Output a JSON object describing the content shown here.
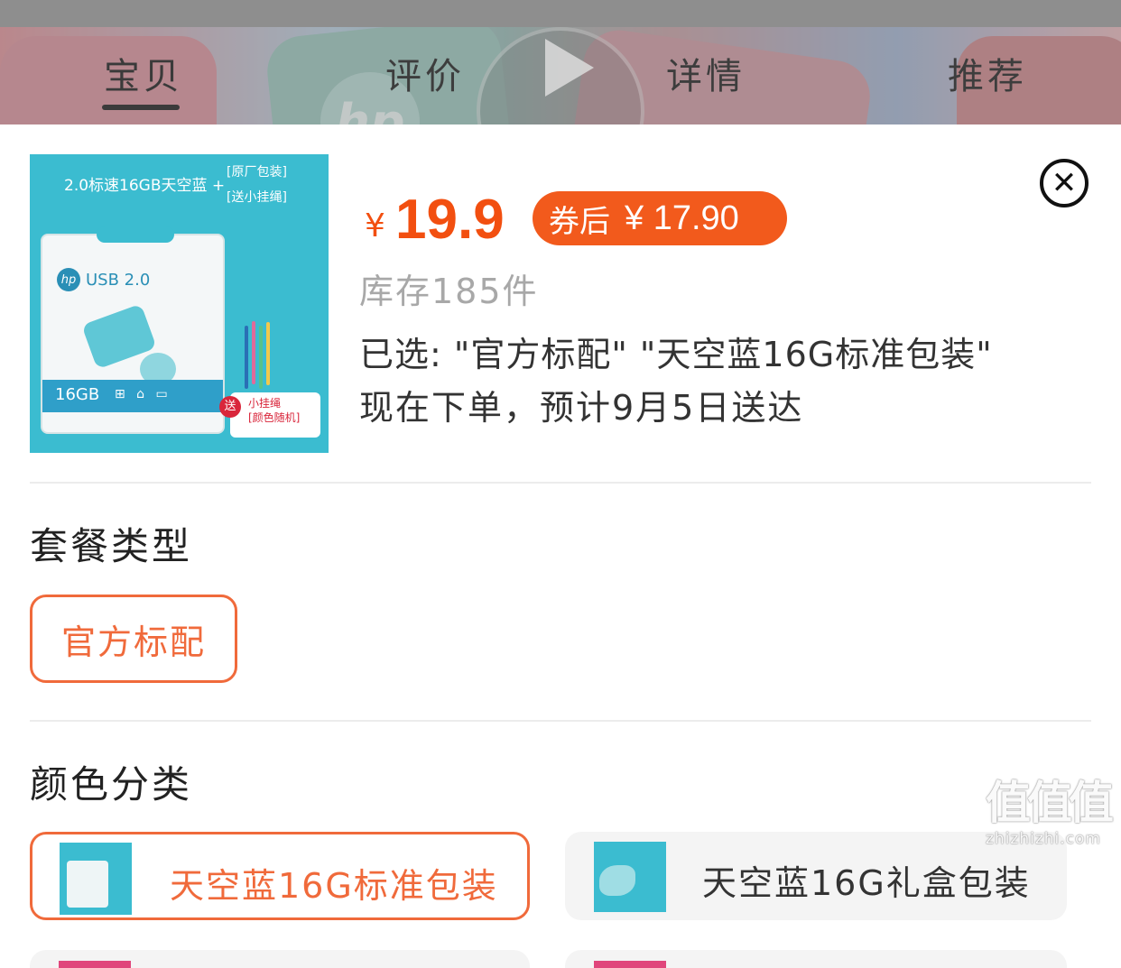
{
  "top_tabs": [
    {
      "label": "宝贝",
      "active": true
    },
    {
      "label": "评价",
      "active": false
    },
    {
      "label": "详情",
      "active": false
    },
    {
      "label": "推荐",
      "active": false
    }
  ],
  "product": {
    "thumb_header": "2.0标速16GB天空蓝 +",
    "thumb_note_1": "[原厂包装]",
    "thumb_note_2": "[送小挂绳]",
    "thumb_brand": "USB 2.0",
    "thumb_brand_mark": "hp",
    "thumb_capacity": "16GB",
    "thumb_gift_badge": "送",
    "thumb_gift_1": "小挂绳",
    "thumb_gift_2": "[颜色随机]",
    "currency": "¥",
    "price": "19.9",
    "coupon_label": "券后",
    "coupon_price": "¥ 17.90",
    "stock": "库存185件",
    "selected_text": "已选: \"官方标配\" \"天空蓝16G标准包装\"",
    "delivery_text": "现在下单，预计9月5日送达"
  },
  "sections": {
    "package_title": "套餐类型",
    "package_options": [
      {
        "label": "官方标配",
        "selected": true
      }
    ],
    "color_title": "颜色分类",
    "color_options": [
      {
        "label": "天空蓝16G标准包装",
        "selected": true
      },
      {
        "label": "天空蓝16G礼盒包装",
        "selected": false
      }
    ]
  },
  "watermark": {
    "glyph": "值值值",
    "url": "zhizhizhi.com"
  },
  "colors": {
    "accent": "#f24f10",
    "chip_border": "#f06a3b",
    "thumb_bg": "#3bbcd0"
  },
  "icons": {
    "close": "close-circle-icon",
    "play": "play-icon"
  }
}
